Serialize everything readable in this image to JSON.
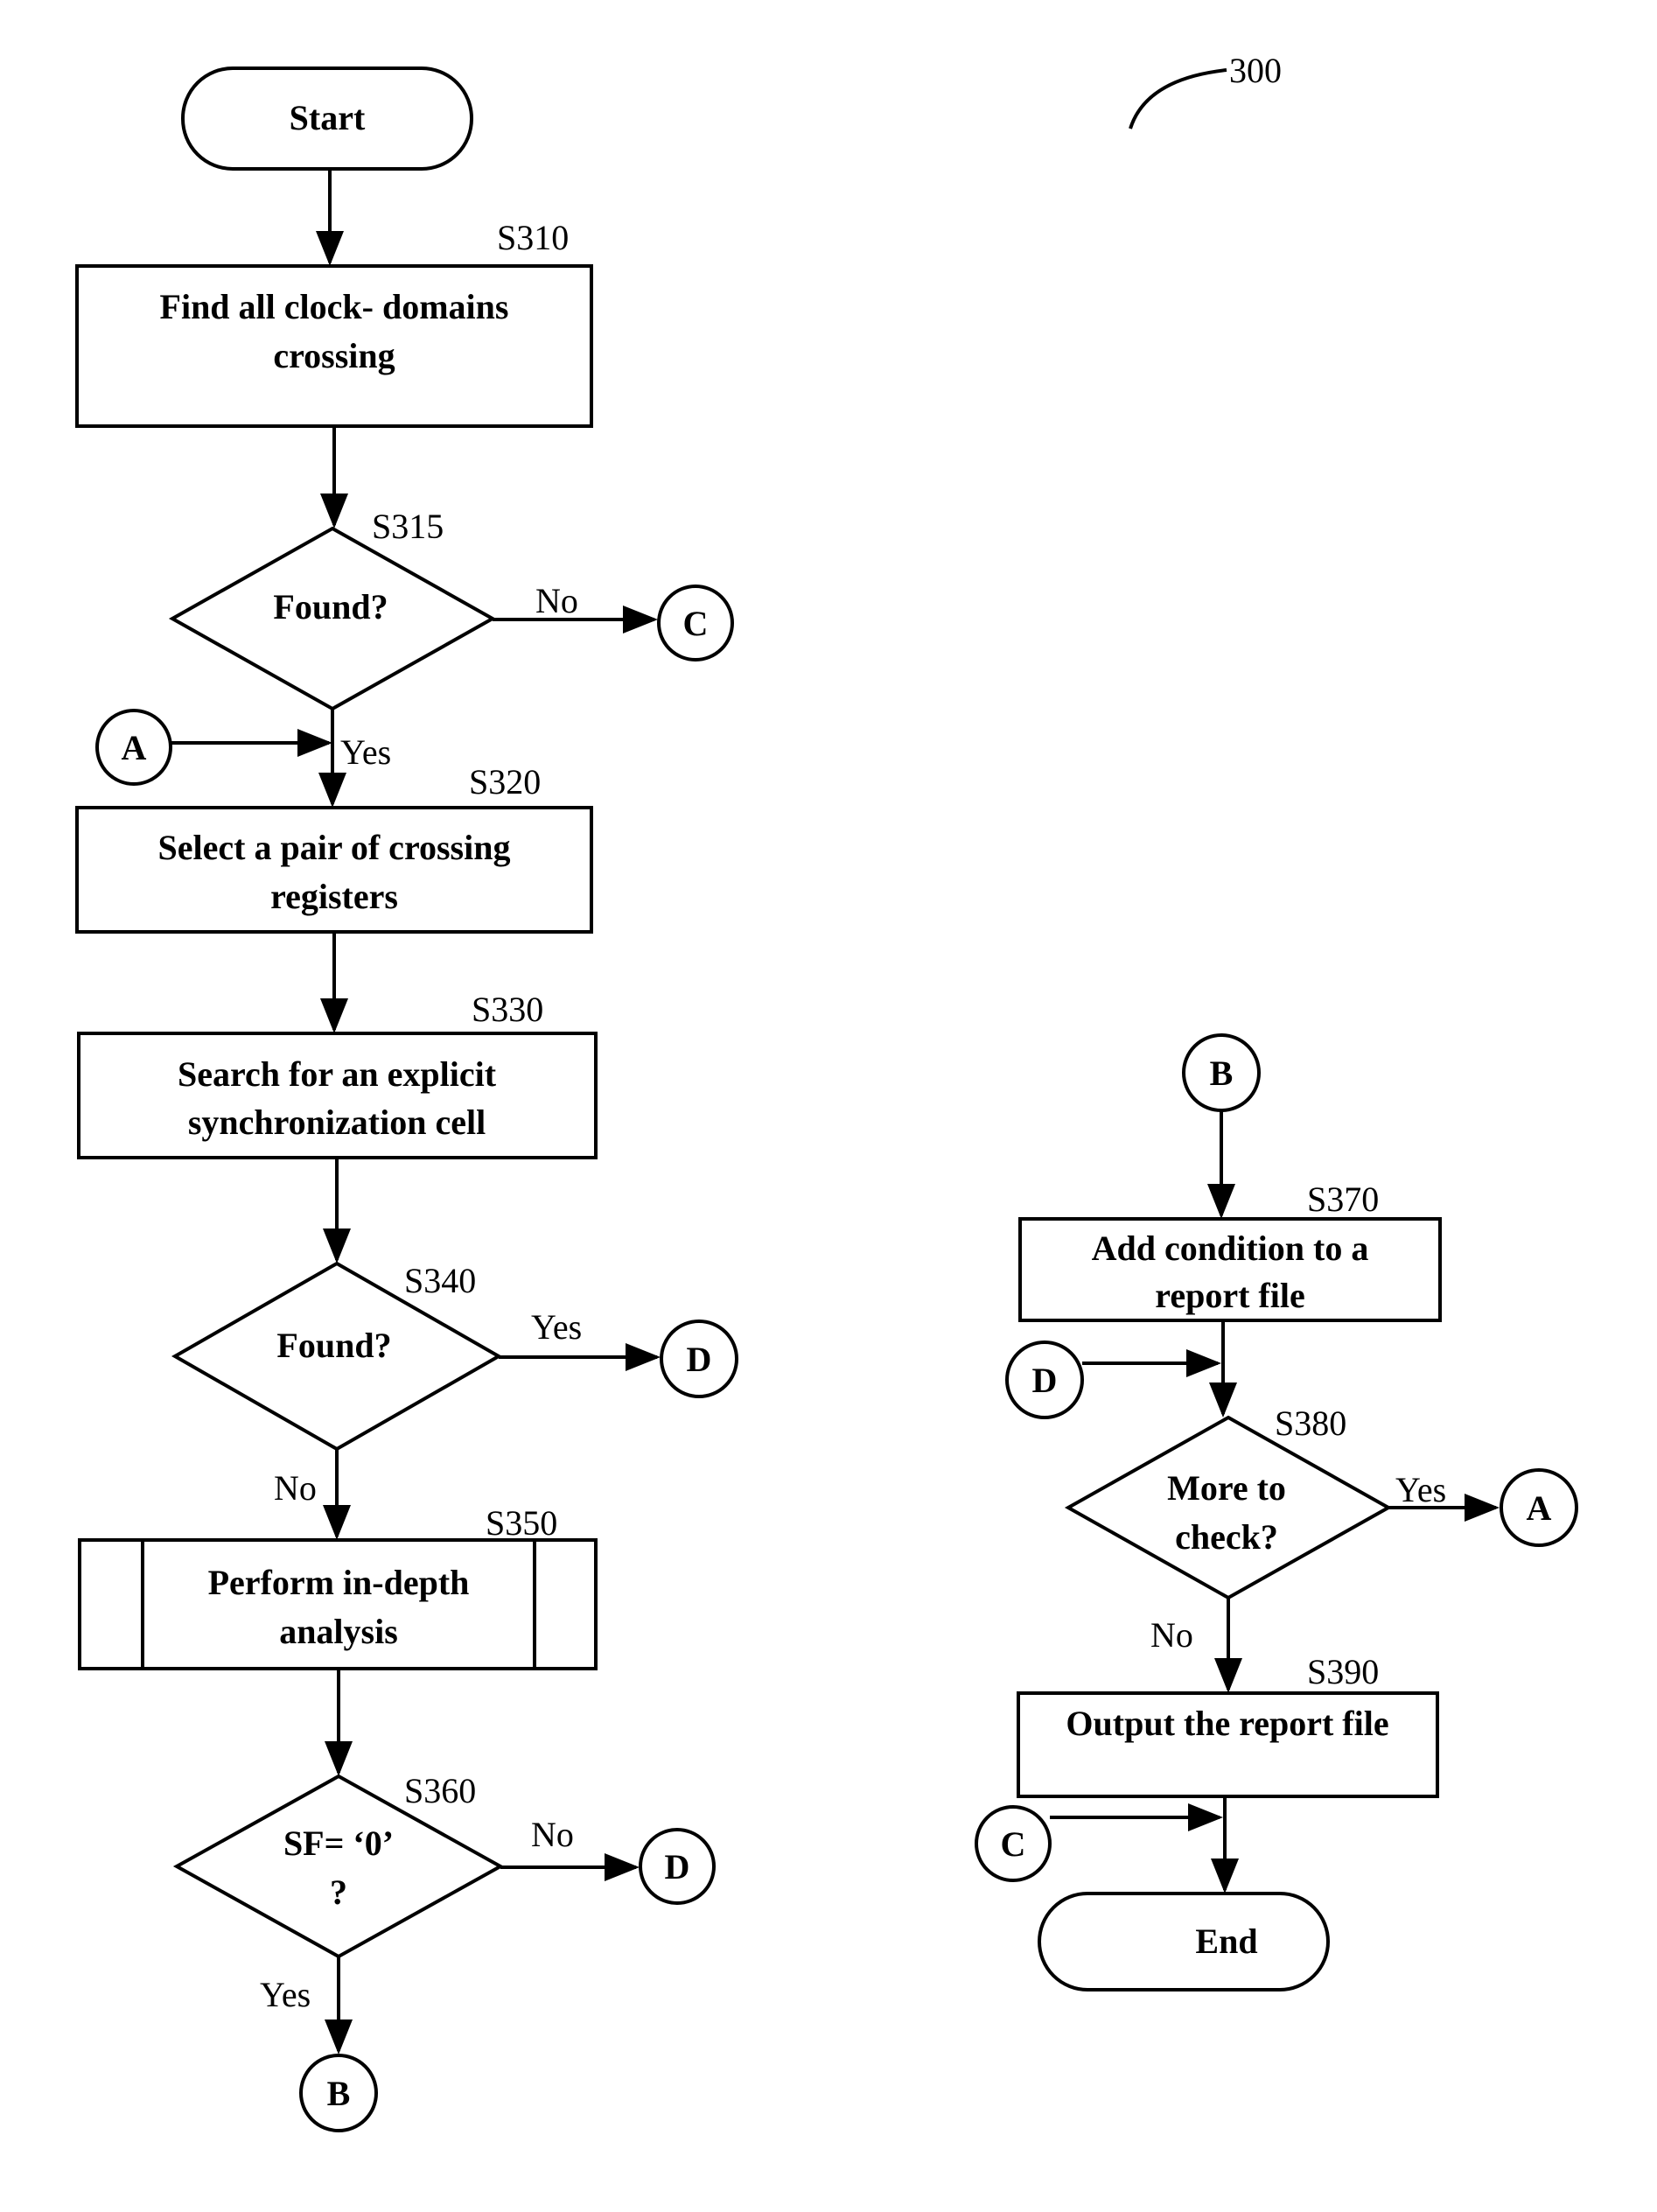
{
  "figure": {
    "ref_number": "300",
    "terminals": {
      "start": "Start",
      "end": "End"
    },
    "steps": {
      "s310": {
        "id": "S310",
        "lines": [
          "Find all clock- domains",
          "crossing"
        ]
      },
      "s315": {
        "id": "S315",
        "lines": [
          "Found?"
        ],
        "no": "No",
        "yes": "Yes"
      },
      "s320": {
        "id": "S320",
        "lines": [
          "Select a pair of crossing",
          "registers"
        ]
      },
      "s330": {
        "id": "S330",
        "lines": [
          "Search for an explicit",
          "synchronization cell"
        ]
      },
      "s340": {
        "id": "S340",
        "lines": [
          "Found?"
        ],
        "yes": "Yes",
        "no": "No"
      },
      "s350": {
        "id": "S350",
        "lines": [
          "Perform in-depth",
          "analysis"
        ]
      },
      "s360": {
        "id": "S360",
        "lines": [
          "SF= ‘0’",
          "?"
        ],
        "no": "No",
        "yes": "Yes"
      },
      "s370": {
        "id": "S370",
        "lines": [
          "Add condition to a",
          "report file"
        ]
      },
      "s380": {
        "id": "S380",
        "lines": [
          "More to",
          "check?"
        ],
        "yes": "Yes",
        "no": "No"
      },
      "s390": {
        "id": "S390",
        "lines": [
          "Output the report file"
        ]
      }
    },
    "connectors": {
      "a": "A",
      "b": "B",
      "c": "C",
      "d": "D"
    }
  }
}
